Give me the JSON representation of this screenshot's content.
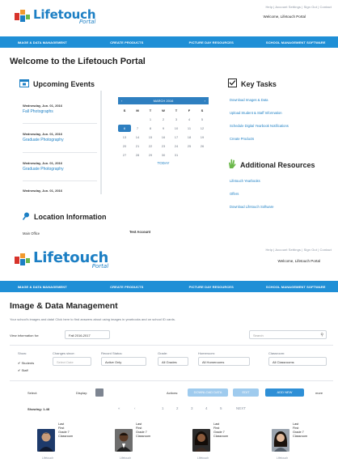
{
  "screen1": {
    "top_links": "Help | Account Settings | Sign Out | Contact",
    "user_name": "Welcome, Lifetouch Portal",
    "logo": {
      "word": "Lifetouch",
      "sub": "Portal"
    },
    "nav": [
      "IMAGE & DATA MANAGEMENT",
      "CREATE PRODUCTS",
      "PICTURE DAY RESOURCES",
      "SCHOOL MANAGEMENT SOFTWARE"
    ],
    "title": "Welcome to the Lifetouch Portal",
    "upcoming_events": {
      "title": "Upcoming Events",
      "events": [
        {
          "date": "Wednesday, Jun. 01, 2016",
          "name": "Fall Photographs"
        },
        {
          "date": "Wednesday, Jun. 01, 2016",
          "name": "Graduate Photography"
        },
        {
          "date": "Wednesday, Jun. 01, 2016",
          "name": "Graduate Photography"
        },
        {
          "date": "Wednesday, Jun. 01, 2016",
          "name": ""
        }
      ]
    },
    "calendar": {
      "month": "MARCH 2016",
      "weekdays": [
        "S",
        "M",
        "T",
        "W",
        "T",
        "F",
        "S"
      ],
      "days": [
        "",
        "",
        "1",
        "2",
        "3",
        "4",
        "5",
        "6",
        "7",
        "8",
        "9",
        "10",
        "11",
        "12",
        "13",
        "14",
        "15",
        "16",
        "17",
        "18",
        "19",
        "20",
        "21",
        "22",
        "23",
        "24",
        "25",
        "26",
        "27",
        "28",
        "29",
        "30",
        "31",
        "",
        ""
      ],
      "today": "6",
      "today_link": "TODAY"
    },
    "key_tasks": {
      "title": "Key Tasks",
      "links": [
        "Download Images & Data",
        "Upload Student & Staff Information",
        "Schedule Digital Yearbook Notifications",
        "Create Products"
      ]
    },
    "additional_resources": {
      "title": "Additional Resources",
      "links": [
        "Lifetouch Yearbooks",
        "Offers",
        "Download Lifetouch Software"
      ]
    },
    "location": {
      "title": "Location Information",
      "label_1": "Main Office",
      "label_2": "Test Account"
    }
  },
  "screen2": {
    "top_links": "Help | Account Settings | Sign Out | Contact",
    "user_name": "Welcome, Lifetouch Portal",
    "logo": {
      "word": "Lifetouch",
      "sub": "Portal"
    },
    "nav": [
      "IMAGE & DATA MANAGEMENT",
      "CREATE PRODUCTS",
      "PICTURE DAY RESOURCES",
      "SCHOOL MANAGEMENT SOFTWARE"
    ],
    "title": "Image & Data Management",
    "intro": "Your school's images and data! Click here to find answers about using images in yearbooks and on school ID cards.",
    "info_label": "View information for:",
    "info_value": "Fall 2016-2017",
    "search_placeholder": "Search",
    "filters": [
      {
        "head": "Show:",
        "value": "Students"
      },
      {
        "head": "Changes since:",
        "value": "Select Date"
      },
      {
        "head": "Record Status:",
        "value": "Active Only"
      },
      {
        "head": "Grade:",
        "value": "All Grades"
      },
      {
        "head": "Homeroom:",
        "value": "All Homerooms"
      },
      {
        "head": "Classroom:",
        "value": "All Classrooms"
      }
    ],
    "staff_label": "Staff",
    "select_label": "Select:",
    "display_label": "Display:",
    "actions_label": "Actions:",
    "actions": [
      "DOWNLOAD DATA",
      "EDIT",
      "ADD NEW"
    ],
    "more_label": "more",
    "showing": "Showing: 1-48",
    "pager": [
      "«",
      "‹",
      "1",
      "2",
      "3",
      "4",
      "5",
      "NEXT"
    ],
    "cards": [
      {
        "lines": [
          "Last",
          "First",
          "Grade 7",
          "Classroom"
        ],
        "caption": "Lifetouch"
      },
      {
        "lines": [
          "Last",
          "First",
          "Grade 7",
          "Classroom"
        ],
        "caption": "Lifetouch"
      },
      {
        "lines": [
          "Last",
          "First",
          "Grade 7",
          "Classroom"
        ],
        "caption": "Lifetouch"
      },
      {
        "lines": [
          "Last",
          "First",
          "Grade 7",
          "Classroom"
        ],
        "caption": "Lifetouch"
      }
    ]
  },
  "colors": {
    "brand_blue": "#1c7fc4",
    "nav_blue": "#1f8fd6",
    "calendar_blue": "#2e7fc0",
    "logo_red": "#d7332b",
    "logo_orange": "#f29a2e",
    "logo_green": "#6bb84a",
    "logo_blue": "#1c7fc4"
  }
}
